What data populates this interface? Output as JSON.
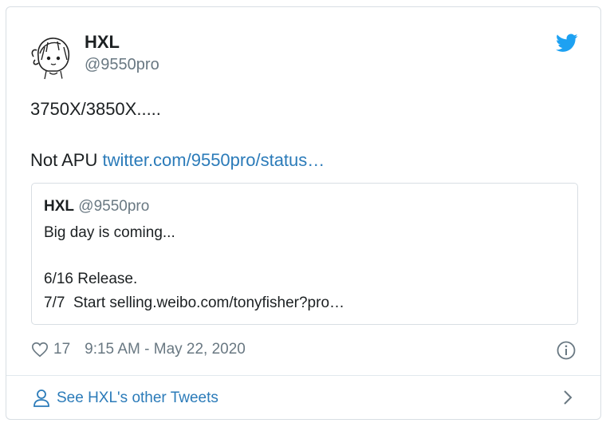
{
  "author": {
    "name": "HXL",
    "handle": "@9550pro"
  },
  "tweet": {
    "line1": "3750X/3850X.....",
    "line2_prefix": "Not APU ",
    "line2_link": "twitter.com/9550pro/status…"
  },
  "quoted": {
    "name": "HXL",
    "handle": "@9550pro",
    "line1": "Big day is coming...",
    "line2": "6/16 Release.",
    "line3": "7/7  Start selling.weibo.com/tonyfisher?pro…"
  },
  "meta": {
    "likes": "17",
    "timestamp": "9:15 AM - May 22, 2020"
  },
  "footer": {
    "label": "See HXL's other Tweets"
  },
  "colors": {
    "link": "#2b7bb9",
    "twitter_blue": "#1da1f2",
    "muted": "#697882"
  },
  "icons": [
    "twitter-bird-icon",
    "heart-icon",
    "info-icon",
    "person-icon",
    "chevron-right-icon"
  ]
}
